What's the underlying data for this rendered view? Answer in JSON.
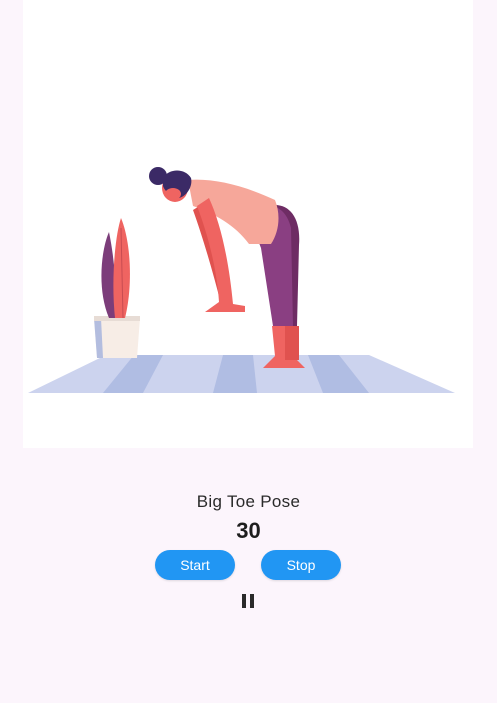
{
  "illustration": {
    "icon": "yoga-forward-fold-illustration"
  },
  "pose": {
    "title": "Big Toe Pose"
  },
  "timer": {
    "value": "30"
  },
  "controls": {
    "start_label": "Start",
    "stop_label": "Stop",
    "pause_icon": "pause-icon"
  },
  "colors": {
    "background": "#fcf5fc",
    "accent": "#2196f3",
    "card": "#ffffff"
  }
}
